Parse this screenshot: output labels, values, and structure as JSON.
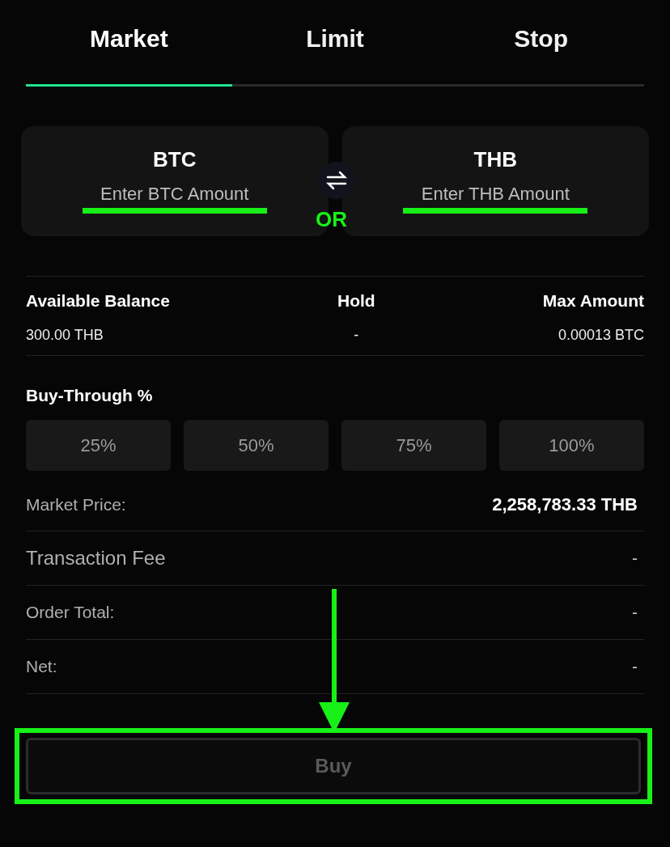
{
  "tabs": [
    {
      "label": "Market",
      "selected": true
    },
    {
      "label": "Limit",
      "selected": false
    },
    {
      "label": "Stop",
      "selected": false
    }
  ],
  "amount_cards": [
    {
      "currency": "BTC",
      "placeholder": "Enter BTC Amount",
      "highlighted": true
    },
    {
      "currency": "THB",
      "placeholder": "Enter THB Amount",
      "highlighted": true
    }
  ],
  "or_annotation": "OR",
  "balance": [
    {
      "label": "Available Balance",
      "value": "300.00 THB"
    },
    {
      "label": "Hold",
      "value": "-"
    },
    {
      "label": "Max Amount",
      "value": "0.00013 BTC"
    }
  ],
  "buy_through": {
    "label": "Buy-Through %",
    "options": [
      {
        "label": "25%",
        "selected": false
      },
      {
        "label": "50%",
        "selected": false
      },
      {
        "label": "75%",
        "selected": false
      },
      {
        "label": "100%",
        "selected": false
      }
    ]
  },
  "summary": [
    {
      "label": "Market Price:",
      "value": "2,258,783.33 THB",
      "kind": "price"
    },
    {
      "label": "Transaction Fee",
      "value": "-",
      "kind": "fee"
    },
    {
      "label": "Order Total:",
      "value": "-",
      "kind": "plain"
    },
    {
      "label": "Net:",
      "value": "-",
      "kind": "plain"
    }
  ],
  "buy_button": {
    "label": "Buy",
    "disabled": true,
    "highlighted": true
  }
}
